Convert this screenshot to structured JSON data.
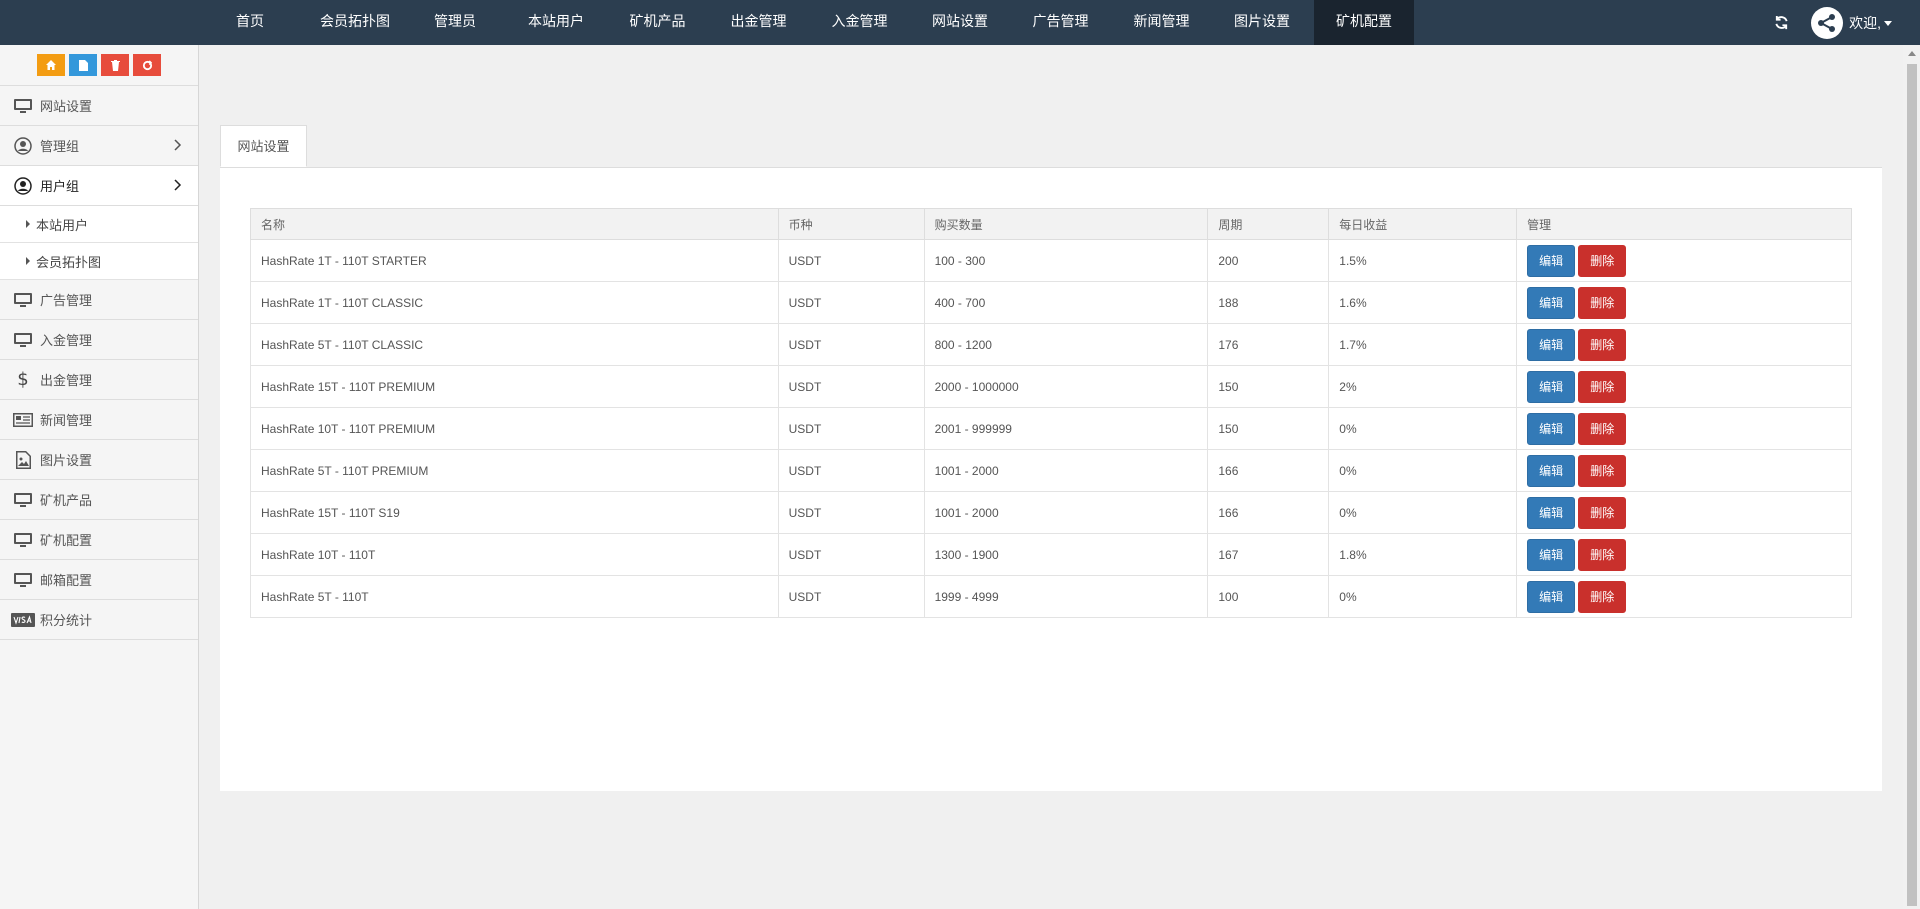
{
  "nav": {
    "items": [
      "首页",
      "会员拓扑图",
      "管理员",
      "本站用户",
      "矿机产品",
      "出金管理",
      "入金管理",
      "网站设置",
      "广告管理",
      "新闻管理",
      "图片设置",
      "矿机配置"
    ],
    "active": "矿机配置",
    "welcome": "欢迎,"
  },
  "sidebar": {
    "shortcut_colors": [
      "#f39c12",
      "#3498db",
      "#e74c3c",
      "#e74c3c"
    ],
    "items": [
      {
        "label": "网站设置",
        "icon": "monitor-icon"
      },
      {
        "label": "管理组",
        "icon": "user-circle-icon"
      },
      {
        "label": "用户组",
        "icon": "user-circle-icon"
      },
      {
        "label": "本站用户"
      },
      {
        "label": "会员拓扑图"
      },
      {
        "label": "广告管理",
        "icon": "monitor-icon"
      },
      {
        "label": "入金管理",
        "icon": "monitor-icon"
      },
      {
        "label": "出金管理",
        "icon": "dollar-icon"
      },
      {
        "label": "新闻管理",
        "icon": "newspaper-icon"
      },
      {
        "label": "图片设置",
        "icon": "image-icon"
      },
      {
        "label": "矿机产品",
        "icon": "monitor-icon"
      },
      {
        "label": "矿机配置",
        "icon": "monitor-icon"
      },
      {
        "label": "邮箱配置",
        "icon": "monitor-icon"
      },
      {
        "label": "积分统计",
        "icon": "visa-icon"
      }
    ]
  },
  "tab": {
    "label": "网站设置"
  },
  "table": {
    "headers": [
      "名称",
      "币种",
      "购买数量",
      "周期",
      "每日收益",
      "管理"
    ],
    "rows": [
      [
        "HashRate 1T - 110T STARTER",
        "USDT",
        "100 - 300",
        "200",
        "1.5%"
      ],
      [
        "HashRate 1T - 110T CLASSIC",
        "USDT",
        "400 - 700",
        "188",
        "1.6%"
      ],
      [
        "HashRate 5T - 110T CLASSIC",
        "USDT",
        "800 - 1200",
        "176",
        "1.7%"
      ],
      [
        "HashRate 15T - 110T PREMIUM",
        "USDT",
        "2000 - 1000000",
        "150",
        "2%"
      ],
      [
        "HashRate 10T - 110T PREMIUM",
        "USDT",
        "2001 - 999999",
        "150",
        "0%"
      ],
      [
        "HashRate 5T - 110T PREMIUM",
        "USDT",
        "1001 - 2000",
        "166",
        "0%"
      ],
      [
        "HashRate 15T - 110T S19",
        "USDT",
        "1001 - 2000",
        "166",
        "0%"
      ],
      [
        "HashRate 10T - 110T",
        "USDT",
        "1300 - 1900",
        "167",
        "1.8%"
      ],
      [
        "HashRate 5T - 110T",
        "USDT",
        "1999 - 4999",
        "100",
        "0%"
      ]
    ],
    "edit_label": "编辑",
    "delete_label": "删除"
  }
}
